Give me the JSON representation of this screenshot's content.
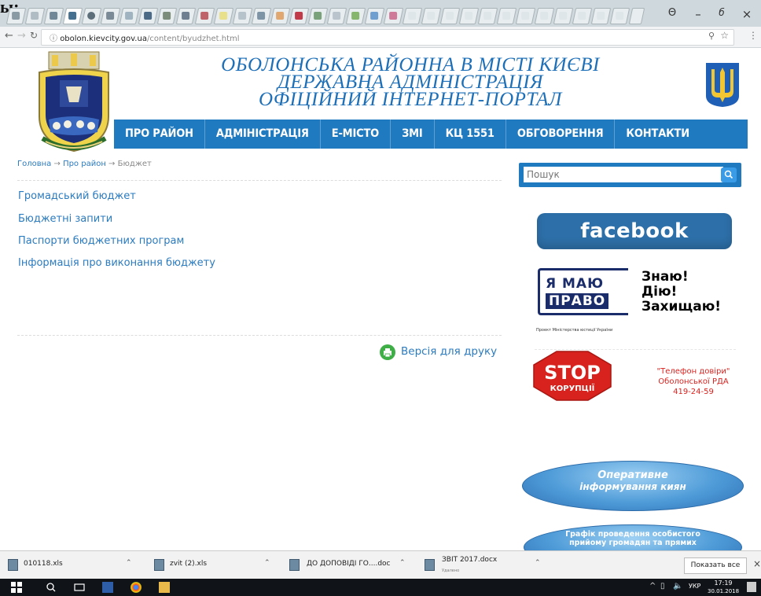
{
  "browser": {
    "leading_text": "ы:",
    "url_host": "obolon.kievcity.gov.ua",
    "url_path": "/content/byudzhet.html",
    "window_controls": [
      "minimize-icon",
      "restore-icon",
      "close-icon"
    ]
  },
  "header": {
    "title_line1": "ОБОЛОНСЬКА РАЙОННА В МІСТІ КИЄВІ",
    "title_line2": "ДЕРЖАВНА АДМІНІСТРАЦІЯ",
    "title_line3": "ОФІЦІЙНИЙ ІНТЕРНЕТ-ПОРТАЛ",
    "title_color": "#1d6fb8"
  },
  "nav": {
    "items": [
      "ПРО РАЙОН",
      "АДМІНІСТРАЦІЯ",
      "Е-МІСТО",
      "ЗМІ",
      "КЦ 1551",
      "ОБГОВОРЕННЯ",
      "КОНТАКТИ"
    ],
    "color": "#1f7ac0"
  },
  "breadcrumb": {
    "home": "Головна",
    "section": "Про район",
    "current": "Бюджет",
    "separator": "→"
  },
  "content": {
    "links": [
      "Громадський бюджет",
      "Бюджетні запити",
      "Паспорти бюджетних програм",
      "Інформація про виконання бюджету"
    ],
    "print_label": "Версія для друку"
  },
  "sidebar": {
    "search_placeholder": "Пошук",
    "facebook_label": "facebook",
    "pravo_line1": "Я МАЮ",
    "pravo_line2": "ПРАВО",
    "pravo_slogan1": "Знаю!",
    "pravo_slogan2": "Дію!",
    "pravo_slogan3": "Захищаю!",
    "pravo_small": "Проект Міністерства юстиції України",
    "stop_word": "STOP",
    "stop_sub": "КОРУПЦІЇ",
    "hotline_line1": "\"Телефон довіри\"",
    "hotline_line2": "Оболонської РДА",
    "hotline_phone": "419-24-59",
    "ellipse1_line1": "Оперативне",
    "ellipse1_line2": "інформування киян",
    "ellipse2_line1": "Графік проведення особистого",
    "ellipse2_line2": "прийому громадян та прямих"
  },
  "downloads": {
    "items": [
      {
        "name": "010118.xls",
        "sub": ""
      },
      {
        "name": "zvit (2).xls",
        "sub": ""
      },
      {
        "name": "ДО ДОПОВІДІ ГО....doc",
        "sub": ""
      },
      {
        "name": "ЗВІТ 2017.docx",
        "sub": "Удалено"
      }
    ],
    "show_all": "Показать все"
  },
  "taskbar": {
    "lang": "УКР",
    "time": "17:19",
    "date": "30.01.2018"
  }
}
